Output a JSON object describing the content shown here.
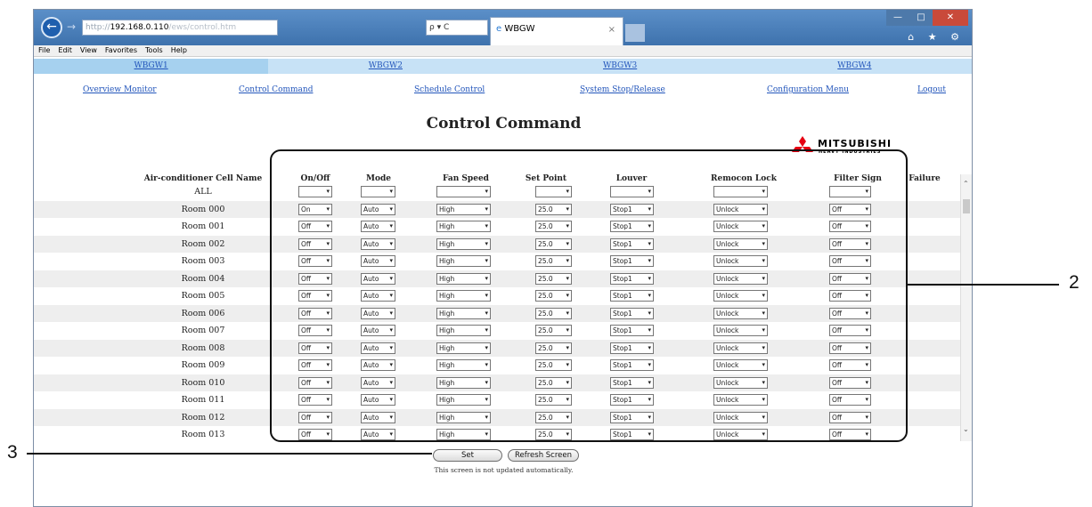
{
  "browser": {
    "address_proto": "http://",
    "address_host": "192.168.0.110",
    "address_rest": "/ews/control.htm",
    "search_glyphs": "ρ ▾ C",
    "tab_title": "WBGW",
    "tab_close": "×",
    "menu": [
      "File",
      "Edit",
      "View",
      "Favorites",
      "Tools",
      "Help"
    ],
    "right_icons": "⌂ ★ ⚙"
  },
  "wbgw_tabs": [
    "WBGW1",
    "WBGW2",
    "WBGW3",
    "WBGW4"
  ],
  "nav": [
    "Overview Monitor",
    "Control Command",
    "Schedule Control",
    "System Stop/Release",
    "Configuration Menu",
    "Logout"
  ],
  "page_title": "Control Command",
  "logo": {
    "name": "MITSUBISHI",
    "sub": "HEAVY INDUSTRIES"
  },
  "columns": {
    "cell_name": "Air-conditioner Cell Name",
    "on_off": "On/Off",
    "mode": "Mode",
    "fan_speed": "Fan Speed",
    "set_point": "Set Point",
    "louver": "Louver",
    "remocon_lock": "Remocon Lock",
    "filter_sign": "Filter Sign",
    "failure": "Failure"
  },
  "all_row_label": "ALL",
  "rows": [
    {
      "name": "Room 000",
      "on_off": "On",
      "mode": "Auto",
      "fan": "High",
      "setpoint": "25.0",
      "louver": "Stop1",
      "lock": "Unlock",
      "filter": "Off"
    },
    {
      "name": "Room 001",
      "on_off": "Off",
      "mode": "Auto",
      "fan": "High",
      "setpoint": "25.0",
      "louver": "Stop1",
      "lock": "Unlock",
      "filter": "Off"
    },
    {
      "name": "Room 002",
      "on_off": "Off",
      "mode": "Auto",
      "fan": "High",
      "setpoint": "25.0",
      "louver": "Stop1",
      "lock": "Unlock",
      "filter": "Off"
    },
    {
      "name": "Room 003",
      "on_off": "Off",
      "mode": "Auto",
      "fan": "High",
      "setpoint": "25.0",
      "louver": "Stop1",
      "lock": "Unlock",
      "filter": "Off"
    },
    {
      "name": "Room 004",
      "on_off": "Off",
      "mode": "Auto",
      "fan": "High",
      "setpoint": "25.0",
      "louver": "Stop1",
      "lock": "Unlock",
      "filter": "Off"
    },
    {
      "name": "Room 005",
      "on_off": "Off",
      "mode": "Auto",
      "fan": "High",
      "setpoint": "25.0",
      "louver": "Stop1",
      "lock": "Unlock",
      "filter": "Off"
    },
    {
      "name": "Room 006",
      "on_off": "Off",
      "mode": "Auto",
      "fan": "High",
      "setpoint": "25.0",
      "louver": "Stop1",
      "lock": "Unlock",
      "filter": "Off"
    },
    {
      "name": "Room 007",
      "on_off": "Off",
      "mode": "Auto",
      "fan": "High",
      "setpoint": "25.0",
      "louver": "Stop1",
      "lock": "Unlock",
      "filter": "Off"
    },
    {
      "name": "Room 008",
      "on_off": "Off",
      "mode": "Auto",
      "fan": "High",
      "setpoint": "25.0",
      "louver": "Stop1",
      "lock": "Unlock",
      "filter": "Off"
    },
    {
      "name": "Room 009",
      "on_off": "Off",
      "mode": "Auto",
      "fan": "High",
      "setpoint": "25.0",
      "louver": "Stop1",
      "lock": "Unlock",
      "filter": "Off"
    },
    {
      "name": "Room 010",
      "on_off": "Off",
      "mode": "Auto",
      "fan": "High",
      "setpoint": "25.0",
      "louver": "Stop1",
      "lock": "Unlock",
      "filter": "Off"
    },
    {
      "name": "Room 011",
      "on_off": "Off",
      "mode": "Auto",
      "fan": "High",
      "setpoint": "25.0",
      "louver": "Stop1",
      "lock": "Unlock",
      "filter": "Off"
    },
    {
      "name": "Room 012",
      "on_off": "Off",
      "mode": "Auto",
      "fan": "High",
      "setpoint": "25.0",
      "louver": "Stop1",
      "lock": "Unlock",
      "filter": "Off"
    },
    {
      "name": "Room 013",
      "on_off": "Off",
      "mode": "Auto",
      "fan": "High",
      "setpoint": "25.0",
      "louver": "Stop1",
      "lock": "Unlock",
      "filter": "Off"
    }
  ],
  "buttons": {
    "set": "Set",
    "refresh": "Refresh Screen"
  },
  "note": "This screen is not updated automatically.",
  "callouts": {
    "two": "2",
    "three": "3"
  },
  "colors": {
    "link": "#2255bb",
    "tab_bar": "#c7e2f6",
    "logo_red": "#e60012"
  }
}
